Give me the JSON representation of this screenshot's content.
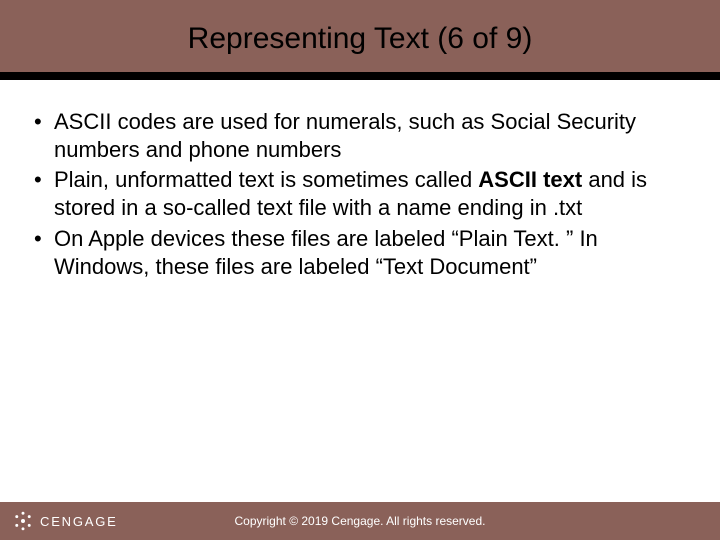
{
  "title": "Representing Text (6 of 9)",
  "bullets": {
    "b1": "ASCII codes are used for numerals, such as Social Security numbers and phone numbers",
    "b2a": "Plain, unformatted text is sometimes called ",
    "b2bold": "ASCII text",
    "b2b": " and is stored in a so-called text file with a name ending in .txt",
    "b3": "On Apple devices these files are labeled “Plain Text. ” In Windows, these files are labeled “Text Document”"
  },
  "footer": {
    "brand": "CENGAGE",
    "copyright": "Copyright © 2019 Cengage. All rights reserved."
  },
  "colors": {
    "band": "#8a6159",
    "underline": "#000000",
    "content_bg": "#ffffff"
  }
}
